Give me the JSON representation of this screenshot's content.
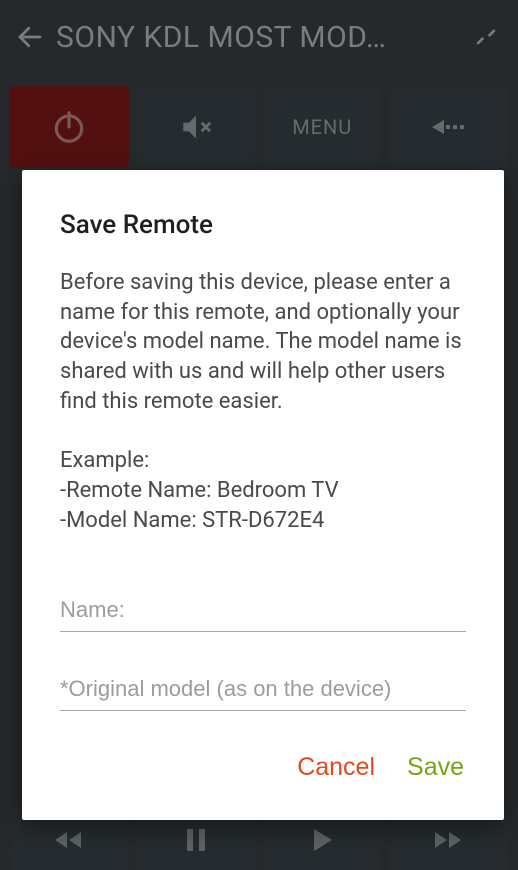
{
  "header": {
    "title": "SONY KDL MOST MOD…"
  },
  "remote_row": {
    "menu_label": "MENU"
  },
  "dialog": {
    "title": "Save Remote",
    "body": "Before saving this device, please enter a name for this remote, and optionally your device's model name. The model name is shared with us and will help other users find this remote easier.\n\nExample:\n-Remote Name: Bedroom TV\n-Model Name: STR-D672E4",
    "name_placeholder": "Name:",
    "model_placeholder": "*Original model (as on the device)",
    "cancel_label": "Cancel",
    "save_label": "Save"
  }
}
